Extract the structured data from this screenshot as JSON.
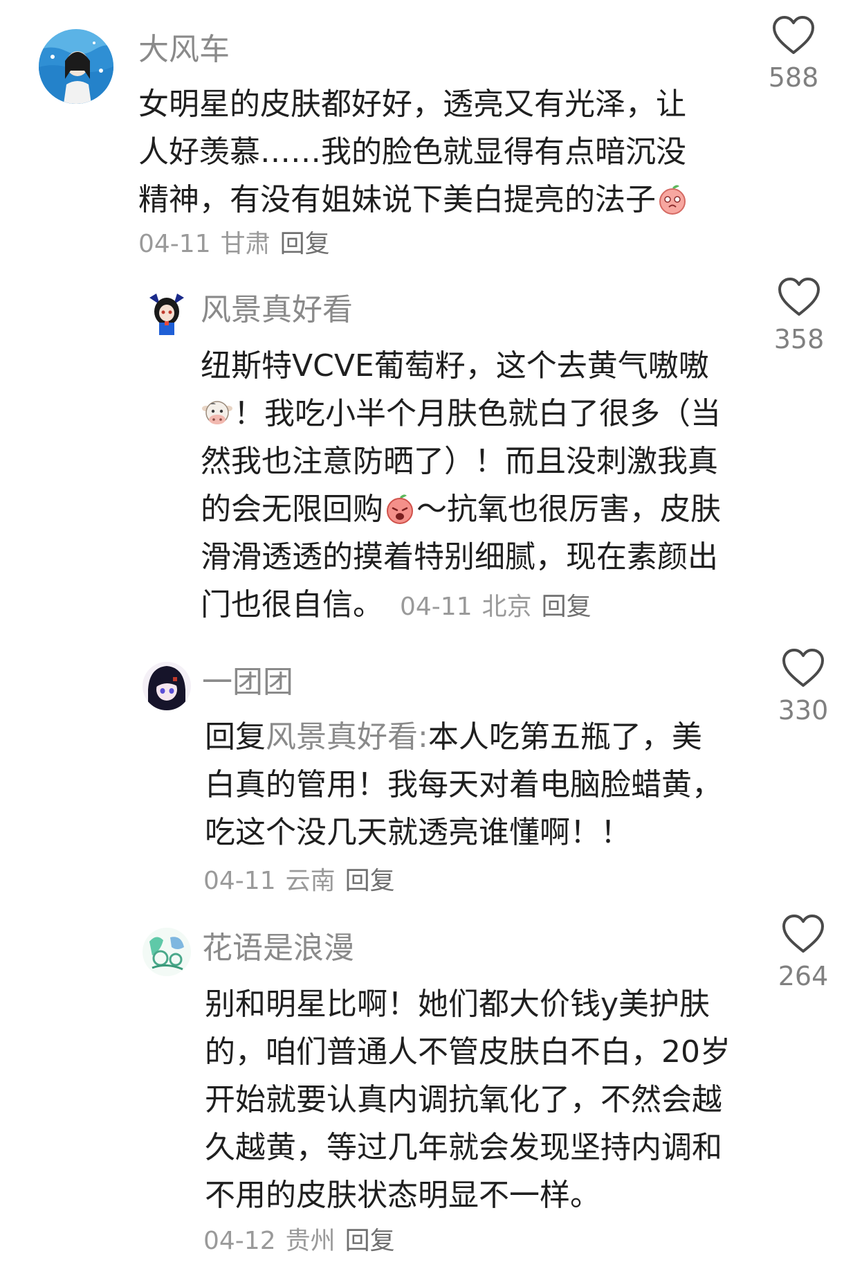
{
  "comments": [
    {
      "username": "大风车",
      "text": "女明星的皮肤都好好，透亮又有光泽，让人好羡慕……我的脸色就显得有点暗沉没精神，有没有姐妹说下美白提亮的法子",
      "date": "04-11",
      "location": "甘肃",
      "reply_label": "回复",
      "likes": "588",
      "emoji": "peach-emoji"
    },
    {
      "username": "风景真好看",
      "text_1": "纽斯特VCVE葡萄籽，这个去黄气嗷嗷",
      "text_2": "！我吃小半个月肤色就白了很多（当然我也注意防晒了）！而且没刺激我真的会无限回购",
      "text_3": "～抗氧也很厉害，皮肤滑滑透透的摸着特别细腻，现在素颜出门也很自信。",
      "date": "04-11",
      "location": "北京",
      "reply_label": "回复",
      "likes": "358",
      "emoji_1": "cow-emoji",
      "emoji_2": "peach-emoji"
    },
    {
      "username": "一团团",
      "reply_prefix": "回复",
      "reply_target": "风景真好看:",
      "text": "本人吃第五瓶了，美白真的管用！我每天对着电脑脸蜡黄，吃这个没几天就透亮谁懂啊！！",
      "date": "04-11",
      "location": "云南",
      "reply_label": "回复",
      "likes": "330"
    },
    {
      "username": "花语是浪漫",
      "text": "别和明星比啊！她们都大价钱y美护肤的，咱们普通人不管皮肤白不白，20岁开始就要认真内调抗氧化了，不然会越久越黄，等过几年就会发现坚持内调和不用的皮肤状态明显不一样。",
      "date": "04-12",
      "location": "贵州",
      "reply_label": "回复",
      "likes": "264"
    }
  ],
  "colors": {
    "text": "#1f1f1f",
    "muted": "#8a8a8a",
    "like_outline": "#4a4a4a"
  }
}
